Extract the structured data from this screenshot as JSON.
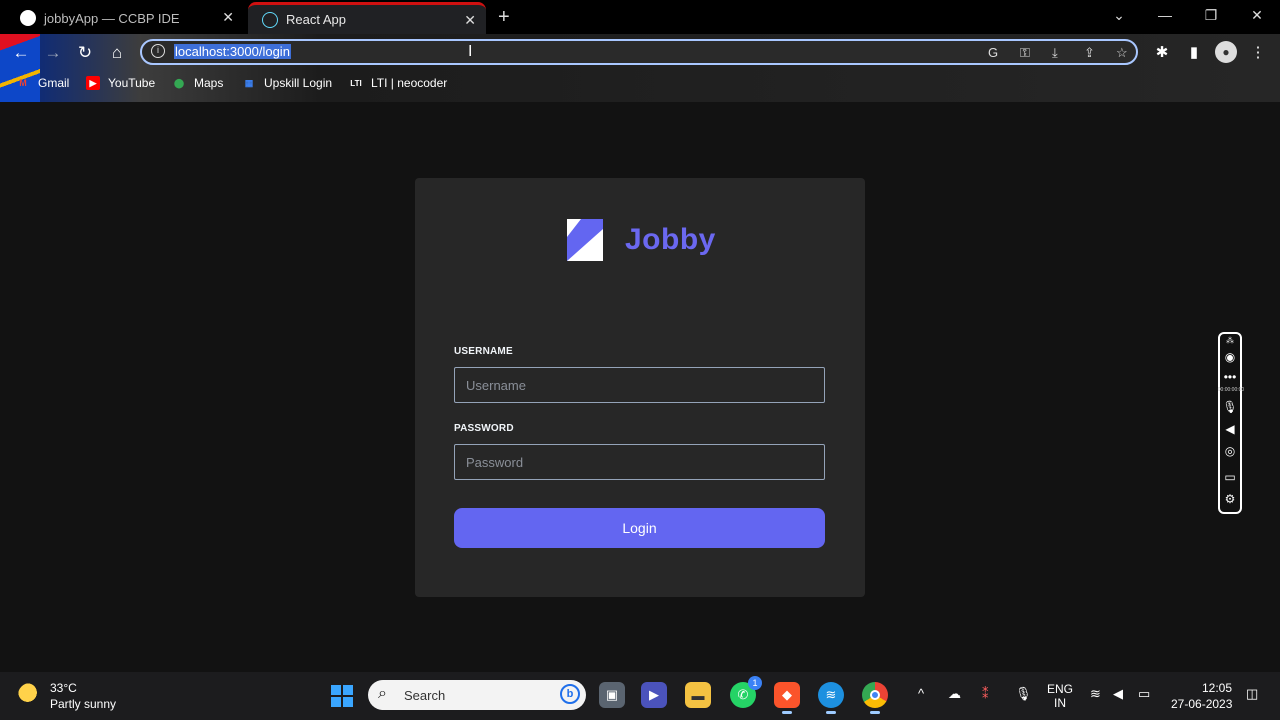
{
  "browser": {
    "tabs": [
      {
        "title": "jobbyApp — CCBP IDE",
        "active": false
      },
      {
        "title": "React App",
        "active": true
      }
    ],
    "url": "localhost:3000/login",
    "bookmarks": [
      {
        "label": "Gmail",
        "icon": "gmail-icon"
      },
      {
        "label": "YouTube",
        "icon": "youtube-icon"
      },
      {
        "label": "Maps",
        "icon": "maps-icon"
      },
      {
        "label": "Upskill Login",
        "icon": "upskill-icon"
      },
      {
        "label": "LTI | neocoder",
        "icon": "lti-icon"
      }
    ]
  },
  "page": {
    "brand": "Jobby",
    "username_label": "USERNAME",
    "username_placeholder": "Username",
    "password_label": "PASSWORD",
    "password_placeholder": "Password",
    "login_label": "Login",
    "accent": "#6366f1"
  },
  "recorder": {
    "time": "00:00:00:00"
  },
  "taskbar": {
    "weather": {
      "temp": "33°C",
      "desc": "Partly sunny"
    },
    "search_label": "Search",
    "whatsapp_badge": "1",
    "lang": {
      "line1": "ENG",
      "line2": "IN"
    },
    "clock": {
      "time": "12:05",
      "date": "27-06-2023"
    }
  }
}
